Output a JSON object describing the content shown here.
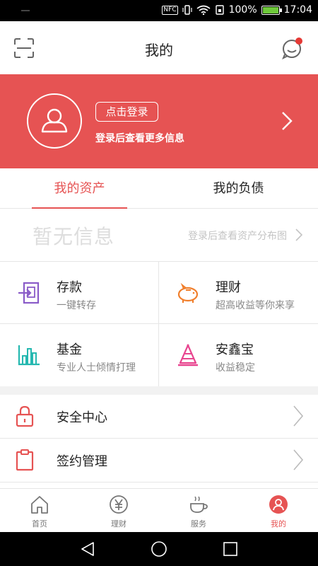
{
  "status_bar": {
    "nfc": "NFC",
    "battery_percent": "100%",
    "time": "17:04"
  },
  "header": {
    "title": "我的",
    "left_icon": "scan-icon",
    "right_icon": "message-icon",
    "has_notification": true
  },
  "banner": {
    "login_button": "点击登录",
    "login_hint": "登录后查看更多信息",
    "background": "#e65353"
  },
  "tabs": [
    {
      "label": "我的资产",
      "active": true
    },
    {
      "label": "我的负债",
      "active": false
    }
  ],
  "assets_info": {
    "empty_text": "暂无信息",
    "link_text": "登录后查看资产分布图"
  },
  "products": [
    {
      "title": "存款",
      "subtitle": "一键转存",
      "icon": "deposit-icon",
      "color": "#8a5cc8"
    },
    {
      "title": "理财",
      "subtitle": "超高收益等你来享",
      "icon": "piggy-bank-icon",
      "color": "#f07f2c"
    },
    {
      "title": "基金",
      "subtitle": "专业人士倾情打理",
      "icon": "fund-chart-icon",
      "color": "#25b8b0"
    },
    {
      "title": "安鑫宝",
      "subtitle": "收益稳定",
      "icon": "cone-icon",
      "color": "#e8458f"
    }
  ],
  "menu": [
    {
      "label": "安全中心",
      "icon": "lock-icon"
    },
    {
      "label": "签约管理",
      "icon": "clipboard-icon"
    }
  ],
  "bottom_nav": [
    {
      "label": "首页",
      "icon": "home-icon",
      "active": false
    },
    {
      "label": "理财",
      "icon": "yen-icon",
      "active": false
    },
    {
      "label": "服务",
      "icon": "coffee-icon",
      "active": false
    },
    {
      "label": "我的",
      "icon": "user-icon",
      "active": true
    }
  ],
  "accent_color": "#e65353"
}
